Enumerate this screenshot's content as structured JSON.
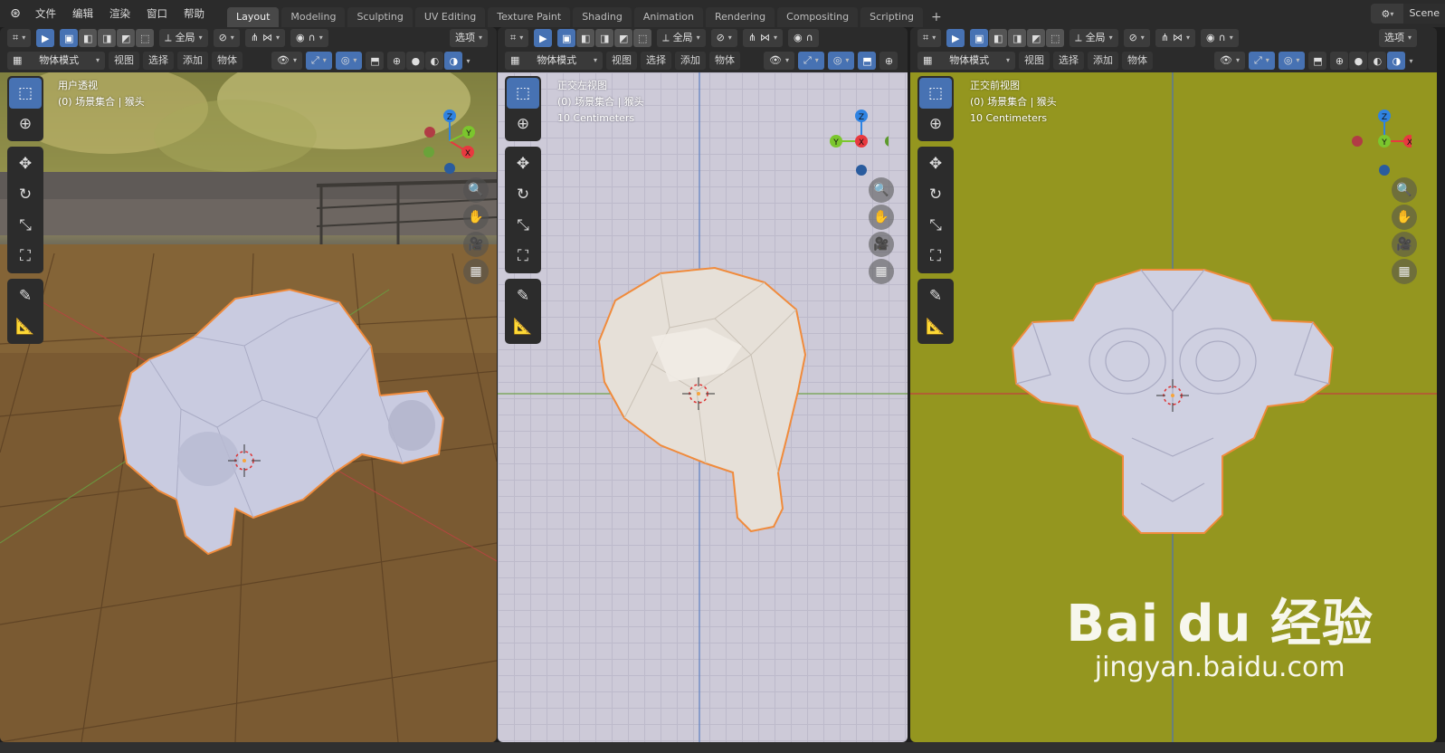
{
  "topbar": {
    "menus": [
      "文件",
      "编辑",
      "渲染",
      "窗口",
      "帮助"
    ],
    "tabs": [
      "Layout",
      "Modeling",
      "Sculpting",
      "UV Editing",
      "Texture Paint",
      "Shading",
      "Animation",
      "Rendering",
      "Compositing",
      "Scripting"
    ],
    "active_tab": "Layout",
    "add_tab": "+",
    "scene": "Scene"
  },
  "header": {
    "transform_orientation": "全局",
    "options": "选项",
    "mode": "物体模式",
    "menu_view": "视图",
    "menu_select": "选择",
    "menu_add": "添加",
    "menu_object": "物体"
  },
  "viewports": [
    {
      "title": "用户透视",
      "collection": "(0) 场景集合 | 猴头",
      "scale": ""
    },
    {
      "title": "正交左视图",
      "collection": "(0) 场景集合 | 猴头",
      "scale": "10 Centimeters"
    },
    {
      "title": "正交前视图",
      "collection": "(0) 场景集合 | 猴头",
      "scale": "10 Centimeters"
    }
  ],
  "gizmo_labels": {
    "x": "X",
    "y": "Y",
    "z": "Z"
  },
  "colors": {
    "accent": "#4772b3",
    "x_axis": "#e8393f",
    "y_axis": "#7bc62d",
    "z_axis": "#2f83e2",
    "selection_outline": "#f08b3c",
    "front_bg": "#94961f",
    "side_bg": "#cdcad8"
  },
  "watermark": {
    "main": "Bai du 经验",
    "sub": "jingyan.baidu.com"
  }
}
